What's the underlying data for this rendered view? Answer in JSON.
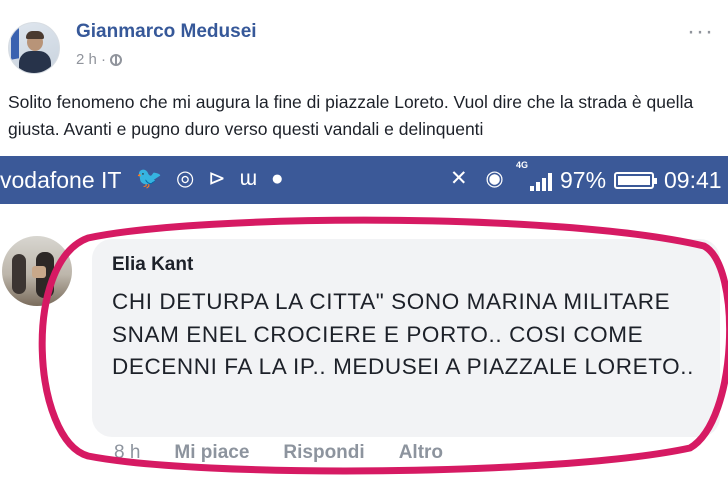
{
  "post": {
    "author": "Gianmarco Medusei",
    "time": "2 h ·",
    "text": "Solito fenomeno che mi augura la fine di piazzale Loreto. Vuol dire che la strada è quella giusta. Avanti e pugno duro verso questi vandali e delinquenti",
    "menu": "···",
    "privacy_icon": "globe-icon"
  },
  "status_bar": {
    "carrier": "vodafone IT",
    "notification_icons": "🐦 ◎ ⊳ ɯ ●",
    "system_icons": "✕ ◉",
    "network": "4G",
    "battery": "97%",
    "time": "09:41",
    "background": "#3b5998"
  },
  "comment": {
    "author": "Elia Kant",
    "text": "CHI DETURPA LA CITTA\" SONO MARINA MILITARE SNAM ENEL CROCIERE E PORTO.. COSI COME DECENNI FA LA IP.. MEDUSEI A PIAZZALE LORETO..",
    "time": "8 h",
    "like": "Mi piace",
    "reply": "Rispondi",
    "more": "Altro"
  },
  "highlight_color": "#d61a63"
}
